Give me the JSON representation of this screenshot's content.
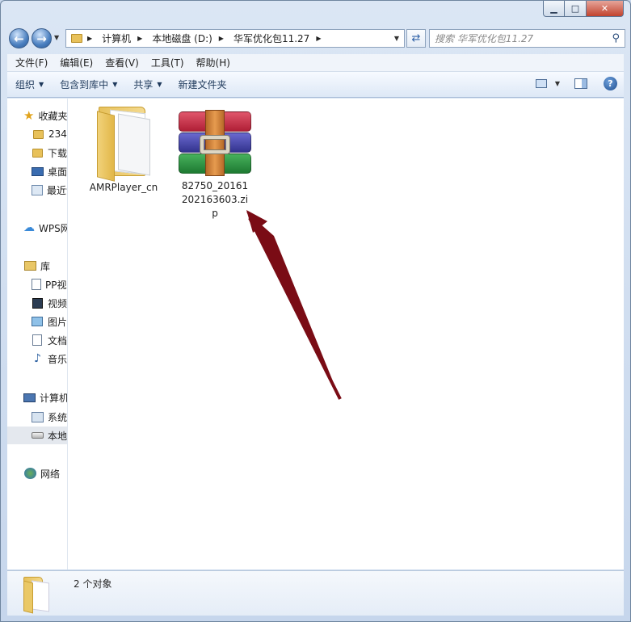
{
  "window": {
    "minimize_glyph": "▁",
    "maximize_glyph": "□",
    "close_glyph": "✕"
  },
  "nav": {
    "back_glyph": "←",
    "forward_glyph": "→",
    "history_glyph": "▼"
  },
  "address_bar": {
    "crumbs": [
      "计算机",
      "本地磁盘 (D:)",
      "华军优化包11.27"
    ],
    "separator": "▶",
    "dropdown_glyph": "▼"
  },
  "refresh_glyph": "⇄",
  "search": {
    "placeholder": "搜索 华军优化包11.27",
    "icon": "search-icon"
  },
  "menu": [
    "文件(F)",
    "编辑(E)",
    "查看(V)",
    "工具(T)",
    "帮助(H)"
  ],
  "command_bar": {
    "items": [
      {
        "label": "组织",
        "caret": "▼"
      },
      {
        "label": "包含到库中",
        "caret": "▼"
      },
      {
        "label": "共享",
        "caret": "▼"
      },
      {
        "label": "新建文件夹",
        "caret": ""
      }
    ],
    "views_caret": "▼",
    "help_glyph": "?"
  },
  "nav_pane": {
    "items": [
      {
        "label": "收藏夹",
        "icon": "star-icon",
        "indent": 0
      },
      {
        "label": "234",
        "icon": "folder-icon",
        "indent": 1
      },
      {
        "label": "下载",
        "icon": "download-folder-icon",
        "indent": 1
      },
      {
        "label": "桌面",
        "icon": "desktop-icon",
        "indent": 1
      },
      {
        "label": "最近访问的位置",
        "icon": "recent-places-icon",
        "indent": 1
      },
      {
        "label": "WPS网盘",
        "icon": "cloud-icon",
        "indent": 0
      },
      {
        "label": "库",
        "icon": "library-icon",
        "indent": 0
      },
      {
        "label": "PP视频",
        "icon": "document-icon",
        "indent": 1
      },
      {
        "label": "视频",
        "icon": "video-icon",
        "indent": 1
      },
      {
        "label": "图片",
        "icon": "picture-icon",
        "indent": 1
      },
      {
        "label": "文档",
        "icon": "document-icon",
        "indent": 1
      },
      {
        "label": "音乐",
        "icon": "music-icon",
        "indent": 1
      },
      {
        "label": "计算机",
        "icon": "computer-icon",
        "indent": 0
      },
      {
        "label": "系统",
        "icon": "system-drive-icon",
        "indent": 1
      },
      {
        "label": "本地磁盘",
        "icon": "drive-icon",
        "indent": 1,
        "selected": true
      },
      {
        "label": "网络",
        "icon": "network-icon",
        "indent": 0
      }
    ],
    "star_glyph": "★",
    "cloud_glyph": "☁",
    "music_glyph": "♪"
  },
  "files": [
    {
      "name": "AMRPlayer_cn",
      "type": "folder",
      "icon": "folder-icon"
    },
    {
      "name": "82750_20161202163603.zip",
      "type": "archive",
      "icon": "winrar-archive-icon"
    }
  ],
  "status": {
    "text": "2 个对象"
  }
}
